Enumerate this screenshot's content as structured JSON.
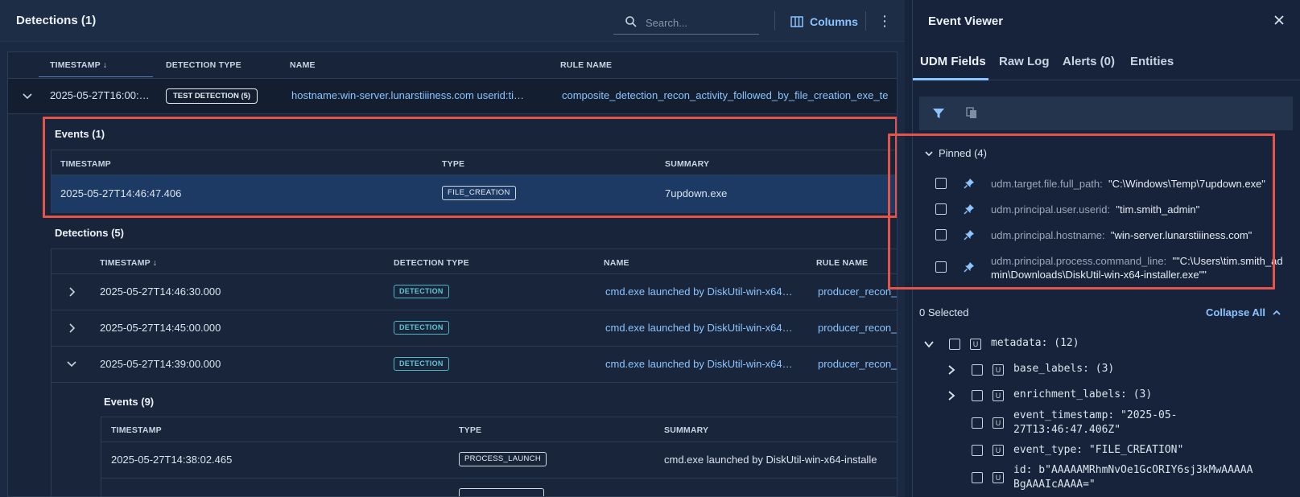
{
  "left": {
    "title": "Detections (1)",
    "search_placeholder": "Search...",
    "columns_label": "Columns",
    "headers": {
      "timestamp": "TIMESTAMP ↓",
      "detection_type": "DETECTION TYPE",
      "name": "NAME",
      "rule_name": "RULE NAME"
    },
    "main_row": {
      "timestamp": "2025-05-27T16:00:…",
      "badge": "TEST DETECTION (5)",
      "name": "hostname:win-server.lunarstiiiness.com userid:ti…",
      "rule": "composite_detection_recon_activity_followed_by_file_creation_exe_te"
    },
    "events": {
      "title": "Events (1)",
      "headers": {
        "timestamp": "TIMESTAMP",
        "type": "TYPE",
        "summary": "SUMMARY"
      },
      "rows": [
        {
          "timestamp": "2025-05-27T14:46:47.406",
          "type": "FILE_CREATION",
          "summary": "7updown.exe"
        }
      ]
    },
    "detections": {
      "title": "Detections (5)",
      "headers": {
        "timestamp": "TIMESTAMP ↓",
        "detection_type": "DETECTION TYPE",
        "name": "NAME",
        "rule_name": "RULE NAME"
      },
      "rows": [
        {
          "timestamp": "2025-05-27T14:46:30.000",
          "type": "DETECTION",
          "name": "cmd.exe launched by DiskUtil-win-x64…",
          "rule": "producer_recon_"
        },
        {
          "timestamp": "2025-05-27T14:45:00.000",
          "type": "DETECTION",
          "name": "cmd.exe launched by DiskUtil-win-x64…",
          "rule": "producer_recon_"
        },
        {
          "timestamp": "2025-05-27T14:39:00.000",
          "type": "DETECTION",
          "name": "cmd.exe launched by DiskUtil-win-x64…",
          "rule": "producer_recon_"
        }
      ]
    },
    "nested_events": {
      "title": "Events (9)",
      "headers": {
        "timestamp": "TIMESTAMP",
        "type": "TYPE",
        "summary": "SUMMARY"
      },
      "rows": [
        {
          "timestamp": "2025-05-27T14:38:02.465",
          "type": "PROCESS_LAUNCH",
          "summary": "cmd.exe launched by DiskUtil-win-x64-installe"
        }
      ]
    }
  },
  "right": {
    "title": "Event Viewer",
    "tabs": [
      "UDM Fields",
      "Raw Log",
      "Alerts (0)",
      "Entities"
    ],
    "pinned_label": "Pinned (4)",
    "pinned": [
      {
        "key": "udm.target.file.full_path:",
        "value": "\"C:\\Windows\\Temp\\7updown.exe\""
      },
      {
        "key": "udm.principal.user.userid:",
        "value": "\"tim.smith_admin\""
      },
      {
        "key": "udm.principal.hostname:",
        "value": "\"win-server.lunarstiiiness.com\""
      },
      {
        "key": "udm.principal.process.command_line:",
        "value": "\"\"C:\\Users\\tim.smith_ad",
        "value_cont": "min\\Downloads\\DiskUtil-win-x64-installer.exe\"\""
      }
    ],
    "selected_count": "0 Selected",
    "collapse_all": "Collapse All",
    "tree": {
      "metadata": "metadata: (12)",
      "base_labels": "base_labels: (3)",
      "enrichment_labels": "enrichment_labels: (3)",
      "event_timestamp_1": "event_timestamp: \"2025-05-",
      "event_timestamp_2": "27T13:46:47.406Z\"",
      "event_type": "event_type: \"FILE_CREATION\"",
      "id_1": "id: b\"AAAAAMRhmNvOe1GcORIY6sj3kMwAAAAA",
      "id_2": "BgAAAIcAAAA=\""
    },
    "u_label": "U"
  },
  "colors": {
    "accent": "#8cc4ff",
    "highlight": "#e5544a",
    "badge_teal": "#62c6d5"
  }
}
